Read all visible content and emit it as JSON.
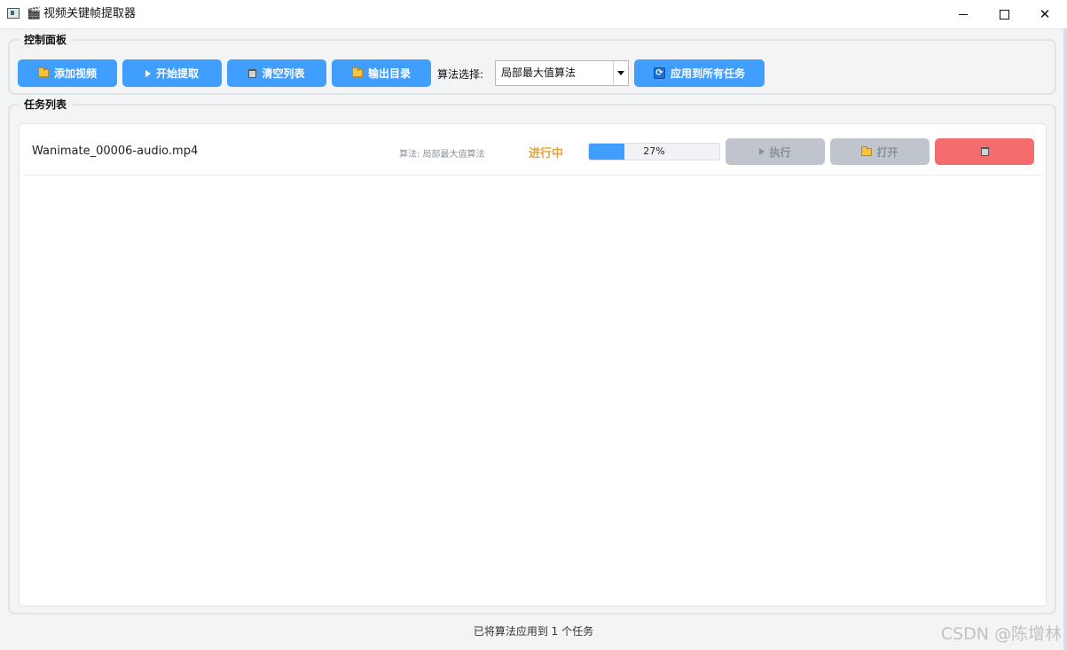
{
  "window": {
    "title": "视频关键帧提取器",
    "minimize": "",
    "maximize": "",
    "close": "✕"
  },
  "control_panel": {
    "title": "控制面板",
    "add_video": "添加视频",
    "start_extract": "开始提取",
    "clear_list": "清空列表",
    "output_dir": "输出目录",
    "algo_label": "算法选择:",
    "algo_selected": "局部最大值算法",
    "apply_all": "应用到所有任务"
  },
  "task_panel": {
    "title": "任务列表",
    "tasks": [
      {
        "file_name": "Wanimate_00006-audio.mp4",
        "algorithm": "算法: 局部最大值算法",
        "status": "进行中",
        "progress": 27,
        "progress_text": "27%",
        "run_label": "执行",
        "open_label": "打开"
      }
    ]
  },
  "status_bar": {
    "message": "已将算法应用到 1 个任务"
  },
  "watermark": "CSDN @陈增林",
  "colors": {
    "primary": "#409eff",
    "disabled": "#c0c4cc",
    "danger": "#f56c6c",
    "warning": "#e6a23c"
  }
}
